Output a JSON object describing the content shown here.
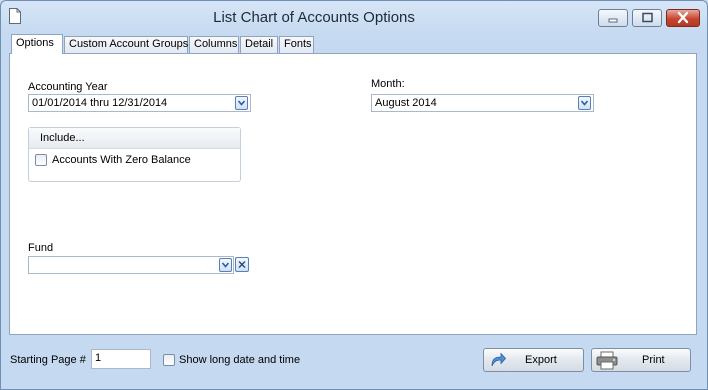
{
  "window": {
    "title": "List Chart of Accounts Options"
  },
  "tabs": [
    {
      "label": "Options",
      "active": true
    },
    {
      "label": "Custom Account Groups",
      "active": false
    },
    {
      "label": "Columns",
      "active": false
    },
    {
      "label": "Detail",
      "active": false
    },
    {
      "label": "Fonts",
      "active": false
    }
  ],
  "options": {
    "accounting_year": {
      "label": "Accounting Year",
      "value": "01/01/2014 thru 12/31/2014"
    },
    "month": {
      "label": "Month:",
      "value": "August 2014"
    },
    "include": {
      "header": "Include...",
      "zero_balance_label": "Accounts With Zero Balance",
      "zero_balance_checked": false
    },
    "fund": {
      "label": "Fund",
      "value": ""
    }
  },
  "footer": {
    "starting_page_label": "Starting Page #",
    "starting_page_value": "1",
    "long_date_label": "Show long date and time",
    "long_date_checked": false,
    "export_label": "Export",
    "print_label": "Print"
  },
  "icons": {
    "app": "document-icon",
    "dropdown": "chevron-down-icon",
    "clear": "close-icon",
    "export": "export-arrow-icon",
    "print": "printer-icon"
  },
  "colors": {
    "accent": "#4f79b4",
    "close_button": "#c8452f",
    "window_bg": "#c5d9f0"
  }
}
